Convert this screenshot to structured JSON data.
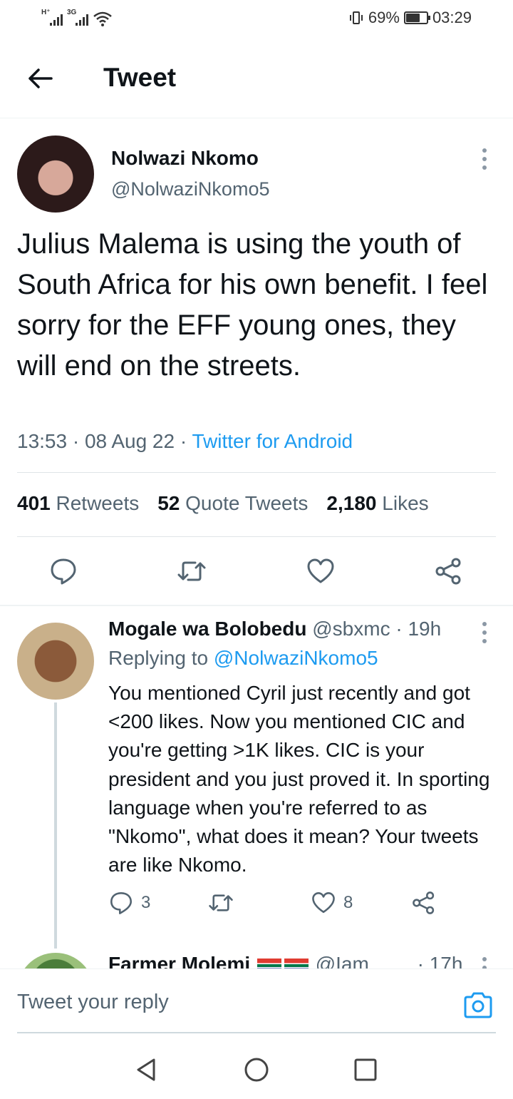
{
  "status_bar": {
    "net1": "H⁺",
    "net2": "3G",
    "battery_percent": "69%",
    "time": "03:29",
    "battery_level": 0.69
  },
  "header": {
    "title": "Tweet",
    "back_icon": "arrow-left-icon"
  },
  "main_tweet": {
    "name": "Nolwazi Nkomo",
    "handle": "@NolwaziNkomo5",
    "text": "Julius Malema is using the youth of South Africa for his own benefit. I feel sorry for the EFF young ones, they will end on the streets.",
    "time": "13:53 · 08 Aug 22 · ",
    "source": "Twitter for Android",
    "stats": {
      "retweets_count": "401",
      "retweets_label": "Retweets",
      "quotes_count": "52",
      "quotes_label": "Quote Tweets",
      "likes_count": "2,180",
      "likes_label": "Likes"
    }
  },
  "reply": {
    "name": "Mogale wa Bolobedu",
    "handle": "@sbxmc · 19h",
    "replying_prefix": "Replying to ",
    "replying_to": "@NolwaziNkomo5",
    "text": "You mentioned Cyril just recently and got <200 likes. Now you mentioned CIC and you're getting >1K likes. CIC is your president and you just proved it. In sporting language when you're referred to as \"Nkomo\", what does it mean? Your tweets are like Nkomo.",
    "reply_count": "3",
    "like_count": "8"
  },
  "next_reply": {
    "name": "Farmer Molemi",
    "handle": "@Iam",
    "time": "· 17h"
  },
  "composer": {
    "placeholder": "Tweet your reply"
  },
  "colors": {
    "accent": "#1d9bf0",
    "text": "#0f1419",
    "secondary": "#536471"
  }
}
